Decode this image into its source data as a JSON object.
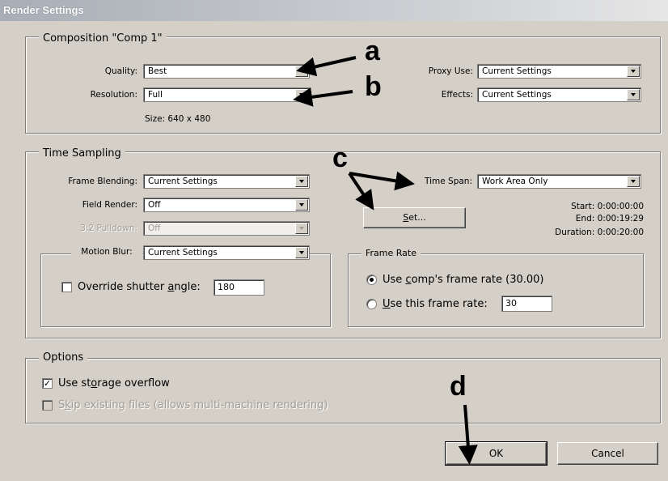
{
  "window": {
    "title": "Render Settings"
  },
  "composition": {
    "legend": "Composition \"Comp 1\"",
    "quality": {
      "label": "Quality:",
      "value": "Best"
    },
    "resolution": {
      "label": "Resolution:",
      "value": "Full"
    },
    "size": "Size: 640 x 480",
    "proxy_use": {
      "label": "Proxy Use:",
      "value": "Current Settings"
    },
    "effects": {
      "label": "Effects:",
      "value": "Current Settings"
    }
  },
  "time_sampling": {
    "legend": "Time Sampling",
    "frame_blending": {
      "label": "Frame Blending:",
      "value": "Current Settings"
    },
    "field_render": {
      "label": "Field Render:",
      "value": "Off"
    },
    "pulldown": {
      "label": "3:2 Pulldown:",
      "value": "Off"
    },
    "motion_blur": {
      "label": "Motion Blur:",
      "value": "Current Settings"
    },
    "override_shutter": {
      "label_pre": "Override shutter ",
      "label_u": "a",
      "label_post": "ngle:",
      "value": "180",
      "checked": false
    },
    "time_span": {
      "label": "Time Span:",
      "value": "Work Area Only"
    },
    "set_button": {
      "label_u": "S",
      "label_post": "et..."
    },
    "start": "Start: 0:00:00:00",
    "end": "End: 0:00:19:29",
    "duration": "Duration: 0:00:20:00",
    "frame_rate": {
      "legend": "Frame Rate",
      "use_comp": {
        "label_pre": "Use ",
        "label_u": "c",
        "label_post": "omp's frame rate  (30.00)",
        "selected": true
      },
      "use_this": {
        "label_u": "U",
        "label_post": "se this frame rate:",
        "value": "30",
        "selected": false
      }
    }
  },
  "options": {
    "legend": "Options",
    "storage_overflow": {
      "label_pre": "Use st",
      "label_u": "o",
      "label_post": "rage overflow",
      "checked": true,
      "mark": "✓"
    },
    "skip_existing": {
      "label_pre": "S",
      "label_u": "k",
      "label_post": "ip existing files (allows multi-machine rendering)",
      "checked": false
    }
  },
  "buttons": {
    "ok": "OK",
    "cancel": "Cancel"
  },
  "annotations": {
    "a": "a",
    "b": "b",
    "c": "c",
    "d": "d"
  }
}
